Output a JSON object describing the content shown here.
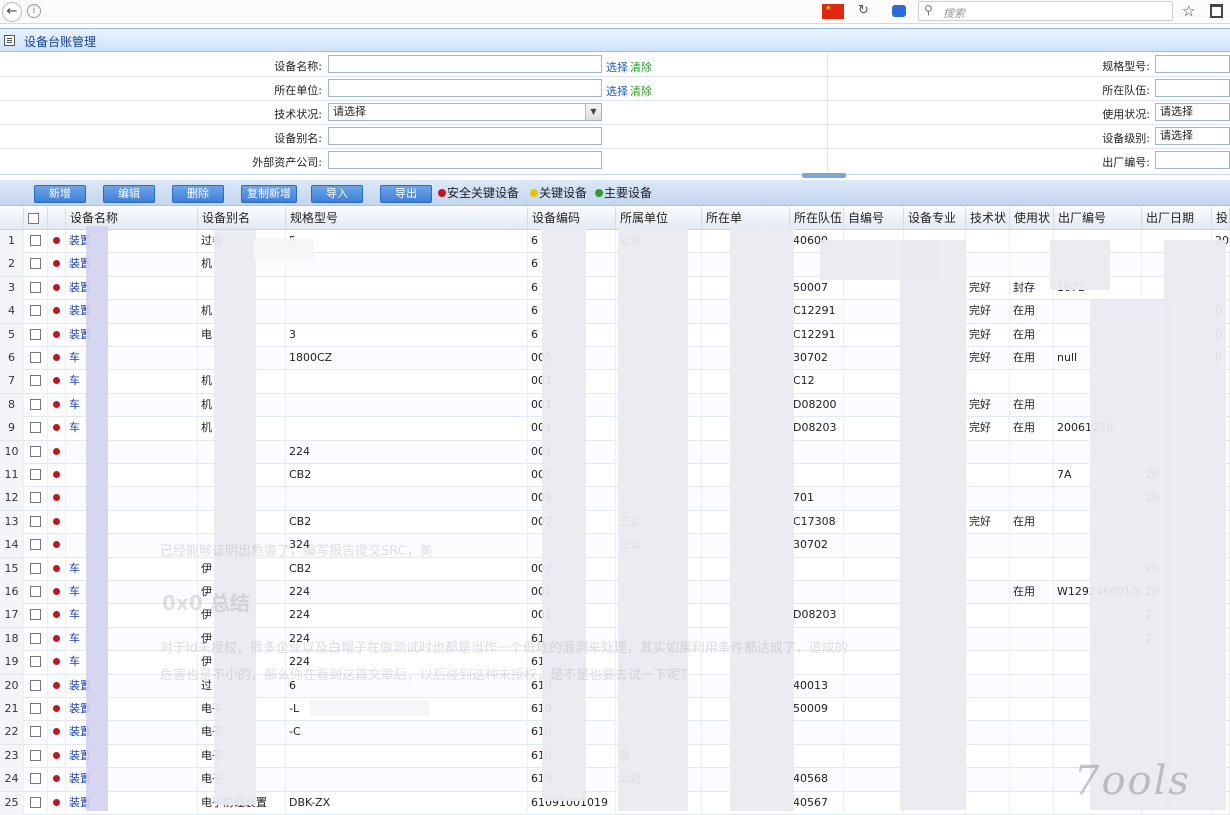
{
  "browser": {
    "search_placeholder": "搜索"
  },
  "panel": {
    "title": "设备台账管理"
  },
  "form": {
    "device_name_label": "设备名称:",
    "unit_label": "所在单位:",
    "tech_status_label": "技术状况:",
    "alias_label": "设备别名:",
    "ext_company_label": "外部资产公司:",
    "spec_label": "规格型号:",
    "team_label": "所在队伍:",
    "use_status_label": "使用状况:",
    "level_label": "设备级别:",
    "factory_no_label": "出厂编号:",
    "select_link": "选择",
    "clear_link": "清除",
    "please_select": "请选择"
  },
  "toolbar": {
    "buttons": [
      "新增",
      "编辑",
      "删除",
      "复制新增",
      "导入",
      "导出"
    ],
    "legend": [
      {
        "label": "安全关键设备",
        "color": "#c0161d"
      },
      {
        "label": "关键设备",
        "color": "#e8c400"
      },
      {
        "label": "主要设备",
        "color": "#2e9d2e"
      }
    ]
  },
  "grid": {
    "headers": [
      "设备名称",
      "设备别名",
      "规格型号",
      "设备编码",
      "所属单位",
      "所在单",
      "所在队伍",
      "自编号",
      "设备专业",
      "技术状",
      "使用状",
      "出厂编号",
      "出厂日期",
      "投"
    ],
    "rows": [
      {
        "n": "1",
        "name": "装置",
        "alias": "过卷",
        "spec": "5",
        "code": "6",
        "unit": "公司",
        "team": "40600",
        "tech": "",
        "use": "",
        "fno": "",
        "date": "",
        "tou": "20"
      },
      {
        "n": "2",
        "name": "装置",
        "alias": "机",
        "spec": "",
        "code": "6",
        "unit": "",
        "team": "",
        "tech": "",
        "use": "",
        "fno": "",
        "date": "",
        "tou": ""
      },
      {
        "n": "3",
        "name": "装置",
        "alias": "",
        "spec": "",
        "code": "6",
        "unit": "",
        "team": "50007",
        "tech": "完好",
        "use": "封存",
        "fno": "1072",
        "date": "",
        "tou": ""
      },
      {
        "n": "4",
        "name": "装置",
        "alias": "机",
        "spec": "",
        "code": "6",
        "unit": "",
        "team": "C12291",
        "tech": "完好",
        "use": "在用",
        "fno": "",
        "date": "",
        "tou": "0"
      },
      {
        "n": "5",
        "name": "装置",
        "alias": "电",
        "spec": "3",
        "code": "6",
        "unit": "",
        "team": "C12291",
        "tech": "完好",
        "use": "在用",
        "fno": "",
        "date": "",
        "tou": "0"
      },
      {
        "n": "6",
        "name": "车",
        "alias": "",
        "spec": "1800CZ",
        "code": "005",
        "unit": "",
        "team": "30702",
        "tech": "完好",
        "use": "在用",
        "fno": "null",
        "date": "",
        "tou": "0"
      },
      {
        "n": "7",
        "name": "车",
        "alias": "机",
        "spec": "",
        "code": "001",
        "unit": "",
        "team": "C12",
        "tech": "",
        "use": "",
        "fno": "",
        "date": "",
        "tou": ""
      },
      {
        "n": "8",
        "name": "车",
        "alias": "机",
        "spec": "",
        "code": "001",
        "unit": "",
        "team": "D08200",
        "tech": "完好",
        "use": "在用",
        "fno": "",
        "date": "",
        "tou": ""
      },
      {
        "n": "9",
        "name": "车",
        "alias": "机",
        "spec": "",
        "code": "001",
        "unit": "",
        "team": "D08203",
        "tech": "完好",
        "use": "在用",
        "fno": "20061220",
        "date": "",
        "tou": ""
      },
      {
        "n": "10",
        "name": "",
        "alias": "",
        "spec": "224",
        "code": "001",
        "unit": "",
        "team": "",
        "tech": "",
        "use": "",
        "fno": "",
        "date": "",
        "tou": ""
      },
      {
        "n": "11",
        "name": "",
        "alias": "",
        "spec": "CB2",
        "code": "007",
        "unit": "",
        "team": "",
        "tech": "",
        "use": "",
        "fno": "7A",
        "date": "20",
        "tou": ""
      },
      {
        "n": "12",
        "name": "",
        "alias": "",
        "spec": "",
        "code": "006",
        "unit": "",
        "team": "701",
        "tech": "",
        "use": "",
        "fno": "",
        "date": "20",
        "tou": ""
      },
      {
        "n": "13",
        "name": "",
        "alias": "",
        "spec": "CB2",
        "code": "007",
        "unit": "三公",
        "team": "C17308",
        "tech": "完好",
        "use": "在用",
        "fno": "",
        "date": "",
        "tou": ""
      },
      {
        "n": "14",
        "name": "",
        "alias": "",
        "spec": "324",
        "code": "",
        "unit": "三公",
        "team": "30702",
        "tech": "",
        "use": "",
        "fno": "",
        "date": "",
        "tou": ""
      },
      {
        "n": "15",
        "name": "车",
        "alias": "伊",
        "spec": "CB2",
        "code": "007",
        "unit": "",
        "team": "",
        "tech": "",
        "use": "",
        "fno": "",
        "date": "20",
        "tou": ""
      },
      {
        "n": "16",
        "name": "车",
        "alias": "伊",
        "spec": "224",
        "code": "001",
        "unit": "",
        "team": "",
        "tech": "",
        "use": "在用",
        "fno": "W129246001005",
        "date": "20",
        "tou": ""
      },
      {
        "n": "17",
        "name": "车",
        "alias": "伊",
        "spec": "224",
        "code": "001",
        "unit": "",
        "team": "D08203",
        "tech": "",
        "use": "",
        "fno": "",
        "date": "2",
        "tou": ""
      },
      {
        "n": "18",
        "name": "车",
        "alias": "伊",
        "spec": "224",
        "code": "61",
        "unit": "",
        "team": "",
        "tech": "",
        "use": "",
        "fno": "",
        "date": "2",
        "tou": ""
      },
      {
        "n": "19",
        "name": "车",
        "alias": "伊",
        "spec": "224",
        "code": "61",
        "unit": "",
        "team": "",
        "tech": "",
        "use": "",
        "fno": "",
        "date": "",
        "tou": ""
      },
      {
        "n": "20",
        "name": "装置",
        "alias": "过",
        "spec": "6",
        "code": "610",
        "unit": "",
        "team": "40013",
        "tech": "",
        "use": "",
        "fno": "",
        "date": "",
        "tou": ""
      },
      {
        "n": "21",
        "name": "装置",
        "alias": "电子",
        "spec": "-L",
        "code": "610",
        "unit": "",
        "team": "50009",
        "tech": "",
        "use": "",
        "fno": "",
        "date": "",
        "tou": ""
      },
      {
        "n": "22",
        "name": "装置",
        "alias": "电子",
        "spec": "-C",
        "code": "610",
        "unit": "",
        "team": "",
        "tech": "",
        "use": "",
        "fno": "",
        "date": "",
        "tou": ""
      },
      {
        "n": "23",
        "name": "装置",
        "alias": "电子",
        "spec": "",
        "code": "610",
        "unit": "司",
        "team": "",
        "tech": "",
        "use": "",
        "fno": "",
        "date": "",
        "tou": ""
      },
      {
        "n": "24",
        "name": "装置",
        "alias": "电子",
        "spec": "",
        "code": "610",
        "unit": "公司",
        "team": "40568",
        "tech": "",
        "use": "",
        "fno": "",
        "date": "",
        "tou": ""
      },
      {
        "n": "25",
        "name": "装置",
        "alias": "电子防碰装置",
        "spec": "DBK-ZX",
        "code": "61091001019",
        "unit": "",
        "team": "40567",
        "tech": "",
        "use": "",
        "fno": "",
        "date": "",
        "tou": ""
      }
    ]
  },
  "watermark": {
    "line1": "已经能够证明出危害了，编写报告提交SRC，美",
    "heading": "0x0 总结",
    "line2": "对于id未授权，很多企业以及白帽子在做测试时也都是当作一个低危的漏洞来处理，其实如果利用条件都达成了，造成的",
    "line3": "危害也是不小的，那么你在看到这篇文章后，以后碰到这种未授权，是不是也要去试一下呢？",
    "logo": "7ools"
  }
}
